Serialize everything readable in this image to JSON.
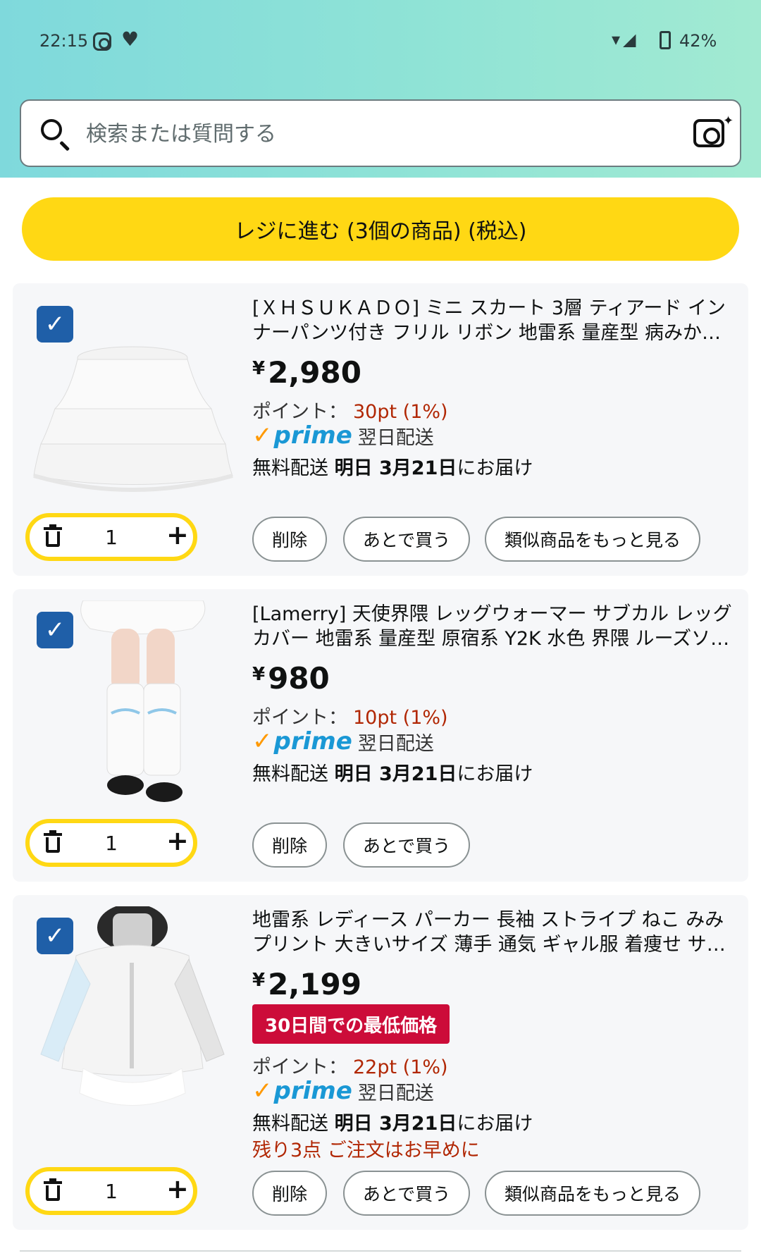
{
  "status_bar": {
    "time": "22:15",
    "battery": "42%"
  },
  "search": {
    "placeholder": "検索または質問する"
  },
  "checkout": {
    "label": "レジに進む (3個の商品) (税込)"
  },
  "colors": {
    "header_gradient_start": "#7fd9dc",
    "accent_yellow": "#ffd814",
    "checkbox_blue": "#1f5fa8",
    "price_red": "#b12704",
    "badge_red": "#cc0c39",
    "prime_blue": "#1a98d5"
  },
  "cart": {
    "items": [
      {
        "title": "[ＸＨＳＵＫＡＤＯ] ミニ スカート 3層 ティアード インナーパンツ付き フリル リボン 地雷系 量産型 病みかわいい…",
        "price": "2,980",
        "currency": "¥",
        "points_label": "ポイント：",
        "points_value": "30pt (1%)",
        "prime_word": "prime",
        "prime_delivery": "翌日配送",
        "delivery_prefix": "無料配送",
        "delivery_date": "明日 3月21日",
        "delivery_suffix": "にお届け",
        "quantity": "1",
        "checked": true,
        "actions": [
          "削除",
          "あとで買う",
          "類似商品をもっと見る"
        ]
      },
      {
        "title": "[Lamerry] 天使界隈 レッグウォーマー サブカル レッグカバー 地雷系 量産型 原宿系 Y2K 水色 界隈 ルーズソック…",
        "price": "980",
        "currency": "¥",
        "points_label": "ポイント：",
        "points_value": "10pt (1%)",
        "prime_word": "prime",
        "prime_delivery": "翌日配送",
        "delivery_prefix": "無料配送",
        "delivery_date": "明日 3月21日",
        "delivery_suffix": "にお届け",
        "quantity": "1",
        "checked": true,
        "actions": [
          "削除",
          "あとで買う"
        ]
      },
      {
        "title": "地雷系 レディース パーカー 長袖 ストライプ ねこ みみ プリント 大きいサイズ 薄手 通気 ギャル服 着痩せ サブカ…",
        "price": "2,199",
        "currency": "¥",
        "badge": "30日間での最低価格",
        "points_label": "ポイント：",
        "points_value": "22pt (1%)",
        "prime_word": "prime",
        "prime_delivery": "翌日配送",
        "delivery_prefix": "無料配送",
        "delivery_date": "明日 3月21日",
        "delivery_suffix": "にお届け",
        "stock_warning": "残り3点 ご注文はお早めに",
        "quantity": "1",
        "checked": true,
        "actions": [
          "削除",
          "あとで買う",
          "類似商品をもっと見る"
        ]
      }
    ]
  }
}
